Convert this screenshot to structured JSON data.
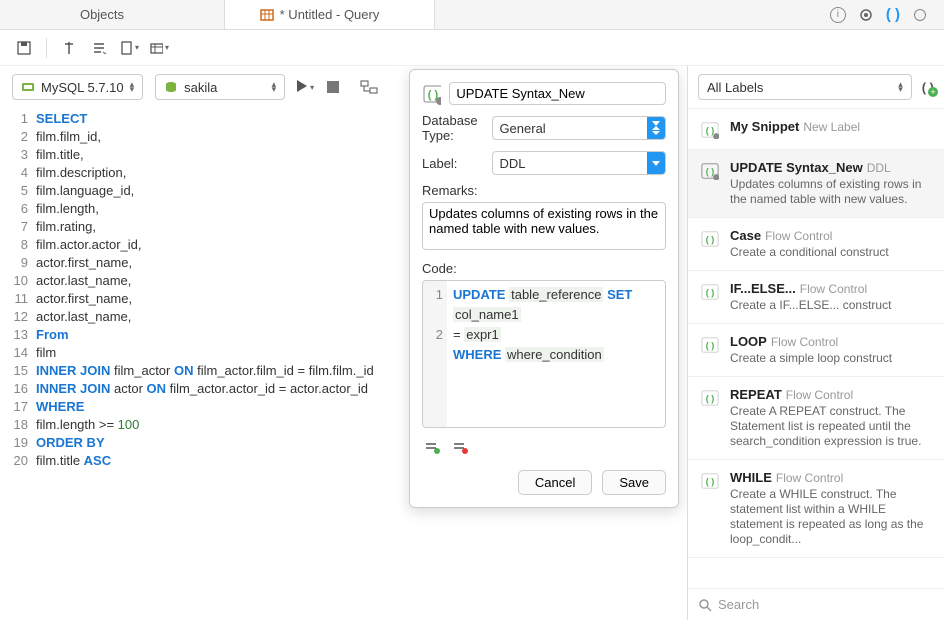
{
  "tabs": {
    "objects": "Objects",
    "query": "* Untitled - Query"
  },
  "connection": {
    "server": "MySQL 5.7.10",
    "database": "sakila"
  },
  "right": {
    "filter": "All Labels",
    "search_placeholder": "Search",
    "items": [
      {
        "title": "My Snippet",
        "tag": "New Label",
        "desc": ""
      },
      {
        "title": "UPDATE Syntax_New",
        "tag": "DDL",
        "desc": "Updates columns of existing rows in the named table with new values."
      },
      {
        "title": "Case",
        "tag": "Flow Control",
        "desc": "Create a conditional construct"
      },
      {
        "title": "IF...ELSE...",
        "tag": "Flow Control",
        "desc": "Create a IF...ELSE... construct"
      },
      {
        "title": "LOOP",
        "tag": "Flow Control",
        "desc": "Create a simple loop construct"
      },
      {
        "title": "REPEAT",
        "tag": "Flow Control",
        "desc": "Create A REPEAT construct. The Statement list is repeated until the search_condition expression is true."
      },
      {
        "title": "WHILE",
        "tag": "Flow Control",
        "desc": "Create a WHILE construct. The statement list within a WHILE statement is repeated as long as the loop_condit..."
      }
    ]
  },
  "panel": {
    "name": "UPDATE Syntax_New",
    "dbtype_label": "Database Type:",
    "dbtype_value": "General",
    "label_label": "Label:",
    "label_value": "DDL",
    "remarks_label": "Remarks:",
    "remarks_value": "Updates columns of existing rows in the named table with new values.",
    "code_label": "Code:",
    "cancel": "Cancel",
    "save": "Save",
    "code_lines": {
      "l1a": "UPDATE",
      "l1b": "table_reference",
      "l1c": "SET",
      "l1d": "col_name1",
      "l2a": "=",
      "l2b": "expr1",
      "l3a": "WHERE",
      "l3b": "where_condition"
    }
  },
  "sql": {
    "l1": "SELECT",
    "l2": "film.film_id,",
    "l3": "film.title,",
    "l4": "film.description,",
    "l5": "film.language_id,",
    "l6": "film.length,",
    "l7": "film.rating,",
    "l8": "film.actor.actor_id,",
    "l9": "actor.first_name,",
    "l10": "actor.last_name,",
    "l11": "actor.first_name,",
    "l12": "actor.last_name,",
    "l13": "From",
    "l14": "film",
    "l15a": "INNER JOIN",
    "l15b": " film_actor ",
    "l15c": "ON",
    "l15d": " film_actor.film_id = film.film._id",
    "l16a": "INNER JOIN",
    "l16b": " actor ",
    "l16c": "ON",
    "l16d": " film_actor.actor_id = actor.actor_id",
    "l17": "WHERE",
    "l18a": "film.length >= ",
    "l18b": "100",
    "l19": "ORDER BY",
    "l20a": "film.title ",
    "l20b": "ASC"
  }
}
